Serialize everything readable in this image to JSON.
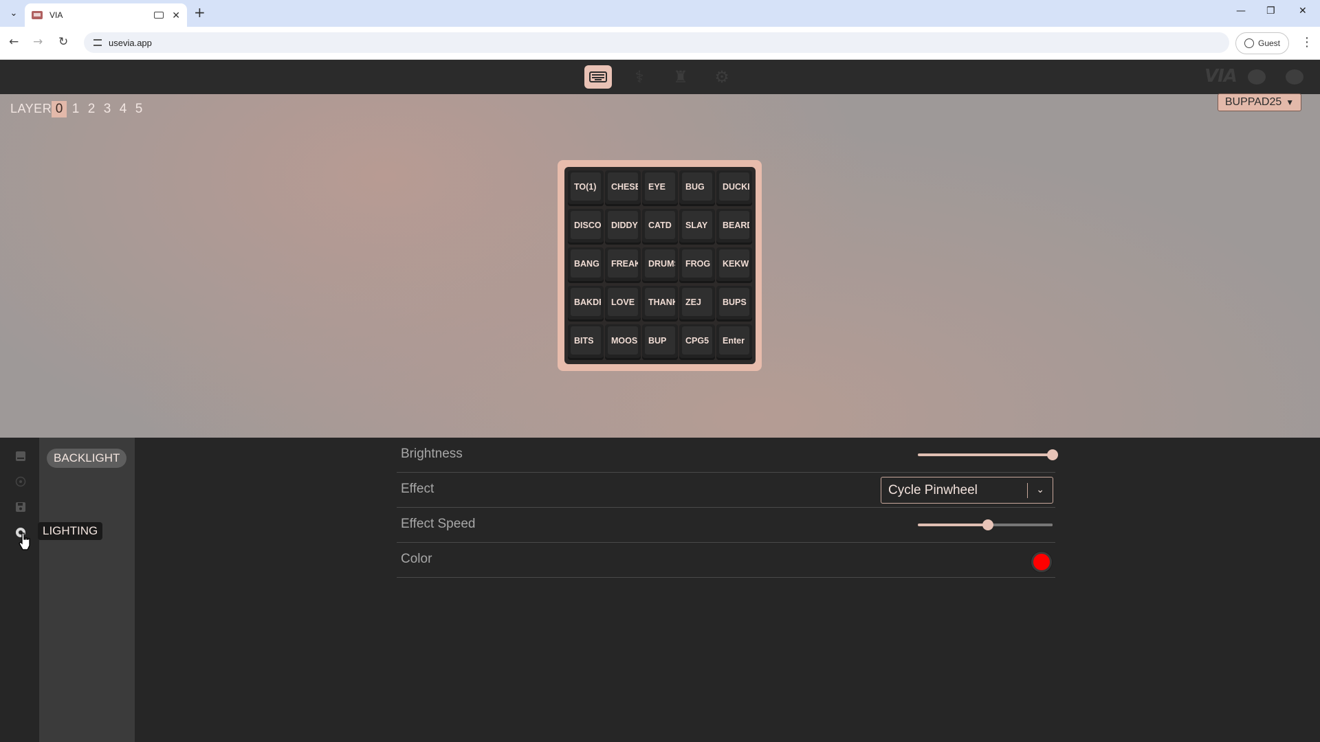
{
  "browser": {
    "tab_title": "VIA",
    "url": "usevia.app",
    "profile_label": "Guest"
  },
  "app": {
    "logo_text": "VIA",
    "nav_icons": [
      "keyboard-icon",
      "stethoscope-icon",
      "paintbrush-icon",
      "gear-icon"
    ],
    "active_nav": "keyboard-icon",
    "brand_icons": [
      "discord-icon",
      "github-icon"
    ]
  },
  "layers": {
    "label": "LAYER",
    "items": [
      "0",
      "1",
      "2",
      "3",
      "4",
      "5"
    ],
    "active": "0"
  },
  "device": {
    "name": "BUPPAD25",
    "chevron": "chevron-down-icon"
  },
  "keys": [
    [
      "TO(1)",
      "CHESE",
      "EYE",
      "BUG",
      "DUCKI"
    ],
    [
      "DISCO",
      "DIDDY",
      "CATD",
      "SLAY",
      "BEARD"
    ],
    [
      "BANG",
      "FREAK",
      "DRUMS",
      "FROG",
      "KEKW"
    ],
    [
      "BAKDR",
      "LOVE",
      "THANK",
      "ZEJ",
      "BUPS"
    ],
    [
      "BITS",
      "MOOSE",
      "BUP",
      "CPG5",
      "Enter"
    ]
  ],
  "sidebar": {
    "rail_icons": [
      "keyboard-icon",
      "circle-plus-icon",
      "save-icon",
      "lighting-icon"
    ],
    "menu_item": "BACKLIGHT",
    "tooltip": "LIGHTING"
  },
  "lighting": {
    "brightness": {
      "label": "Brightness",
      "value": 1.0
    },
    "effect": {
      "label": "Effect",
      "value": "Cycle Pinwheel"
    },
    "effect_speed": {
      "label": "Effect Speed",
      "value": 0.52
    },
    "color": {
      "label": "Color",
      "value": "#ff0000"
    }
  },
  "colors": {
    "accent": "#e3b9aa",
    "background": "#262626"
  }
}
